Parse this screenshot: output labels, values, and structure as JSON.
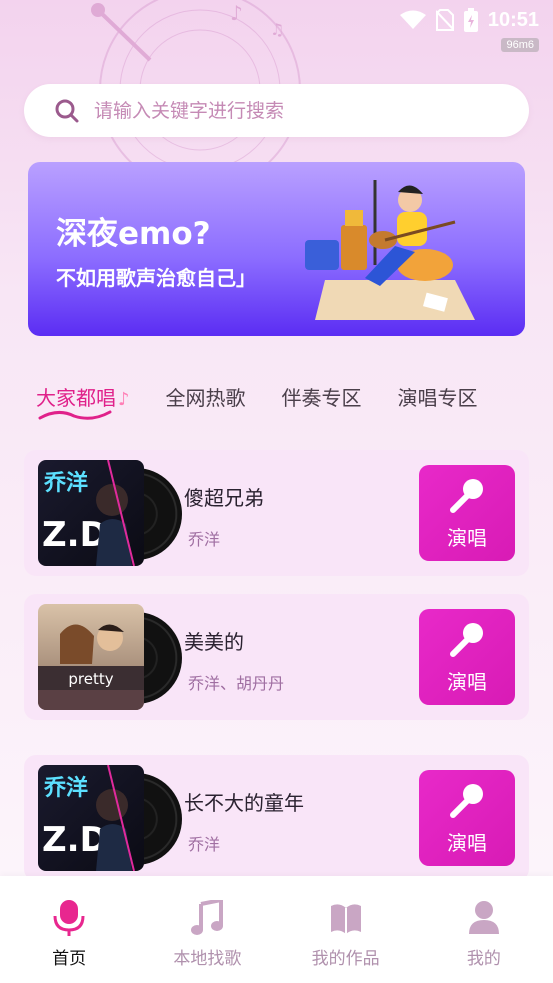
{
  "status_bar": {
    "time": "10:51",
    "badge": "96m6"
  },
  "search": {
    "placeholder": "请输入关键字进行搜索"
  },
  "banner": {
    "title": "深夜emo?",
    "subtitle": "不如用歌声治愈自己」"
  },
  "tabs": [
    {
      "label": "大家都唱",
      "active": true
    },
    {
      "label": "全网热歌",
      "active": false
    },
    {
      "label": "伴奏专区",
      "active": false
    },
    {
      "label": "演唱专区",
      "active": false
    }
  ],
  "songs": [
    {
      "title": "傻超兄弟",
      "artist": "乔洋",
      "action": "演唱",
      "cover_text": "乔洋"
    },
    {
      "title": "美美的",
      "artist": "乔洋、胡丹丹",
      "action": "演唱",
      "cover_text": "pretty"
    },
    {
      "title": "长不大的童年",
      "artist": "乔洋",
      "action": "演唱",
      "cover_text": "乔洋"
    }
  ],
  "bottom_nav": [
    {
      "label": "首页",
      "icon": "microphone-icon",
      "active": true
    },
    {
      "label": "本地找歌",
      "icon": "music-note-icon",
      "active": false
    },
    {
      "label": "我的作品",
      "icon": "book-icon",
      "active": false
    },
    {
      "label": "我的",
      "icon": "user-icon",
      "active": false
    }
  ],
  "colors": {
    "accent": "#e0218a",
    "sing_button": "#e829c9",
    "banner_dark": "#5b2df3"
  }
}
